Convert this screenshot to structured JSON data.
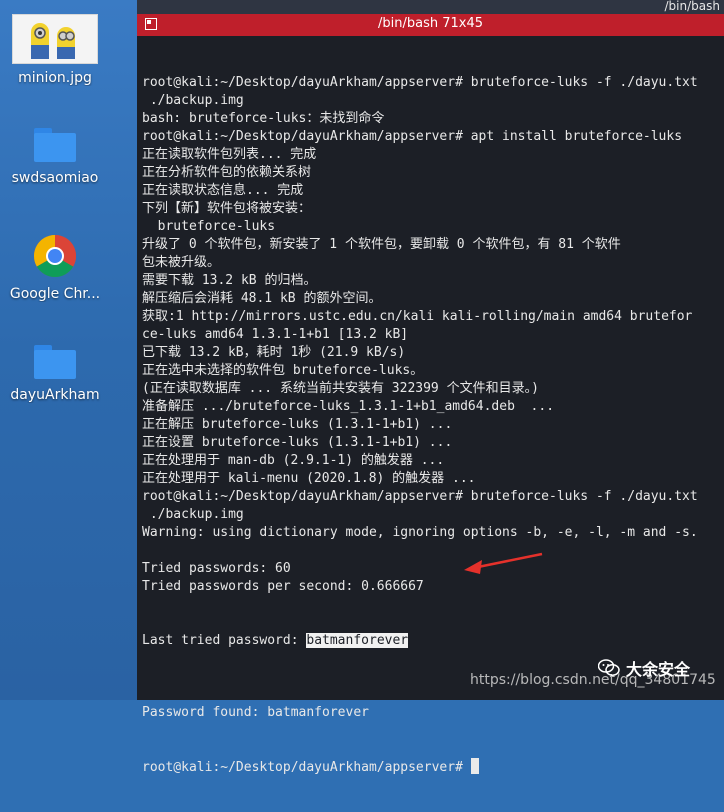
{
  "topbar": {
    "title": "/bin/bash"
  },
  "desktop": {
    "icons": [
      {
        "label": "minion.jpg",
        "kind": "image"
      },
      {
        "label": "swdsaomiao",
        "kind": "folder"
      },
      {
        "label": "Google Chr...",
        "kind": "chrome"
      },
      {
        "label": "dayuArkham",
        "kind": "folder"
      }
    ]
  },
  "terminal": {
    "title": "/bin/bash 71x45",
    "lines": [
      "root@kali:~/Desktop/dayuArkham/appserver# bruteforce-luks -f ./dayu.txt",
      " ./backup.img",
      "bash: bruteforce-luks：未找到命令",
      "root@kali:~/Desktop/dayuArkham/appserver# apt install bruteforce-luks",
      "正在读取软件包列表... 完成",
      "正在分析软件包的依赖关系树",
      "正在读取状态信息... 完成",
      "下列【新】软件包将被安装：",
      "  bruteforce-luks",
      "升级了 0 个软件包，新安装了 1 个软件包，要卸载 0 个软件包，有 81 个软件",
      "包未被升级。",
      "需要下载 13.2 kB 的归档。",
      "解压缩后会消耗 48.1 kB 的额外空间。",
      "获取:1 http://mirrors.ustc.edu.cn/kali kali-rolling/main amd64 brutefor",
      "ce-luks amd64 1.3.1-1+b1 [13.2 kB]",
      "已下载 13.2 kB，耗时 1秒 (21.9 kB/s)",
      "正在选中未选择的软件包 bruteforce-luks。",
      "(正在读取数据库 ... 系统当前共安装有 322399 个文件和目录。)",
      "准备解压 .../bruteforce-luks_1.3.1-1+b1_amd64.deb  ...",
      "正在解压 bruteforce-luks (1.3.1-1+b1) ...",
      "正在设置 bruteforce-luks (1.3.1-1+b1) ...",
      "正在处理用于 man-db (2.9.1-1) 的触发器 ...",
      "正在处理用于 kali-menu (2020.1.8) 的触发器 ...",
      "root@kali:~/Desktop/dayuArkham/appserver# bruteforce-luks -f ./dayu.txt",
      " ./backup.img",
      "Warning: using dictionary mode, ignoring options -b, -e, -l, -m and -s.",
      "",
      "Tried passwords: 60",
      "Tried passwords per second: 0.666667"
    ],
    "last_tried_label": "Last tried password: ",
    "last_tried_value": "batmanforever",
    "after_lines": [
      "",
      "Password found: batmanforever"
    ],
    "prompt": "root@kali:~/Desktop/dayuArkham/appserver# "
  },
  "watermark": "https://blog.csdn.net/qq_34801745",
  "brand": "大余安全",
  "colors": {
    "titlebar": "#bf1f2b",
    "terminal_bg": "#1c1f26",
    "arrow": "#e5312b",
    "desktop": "#2f6fb3"
  }
}
